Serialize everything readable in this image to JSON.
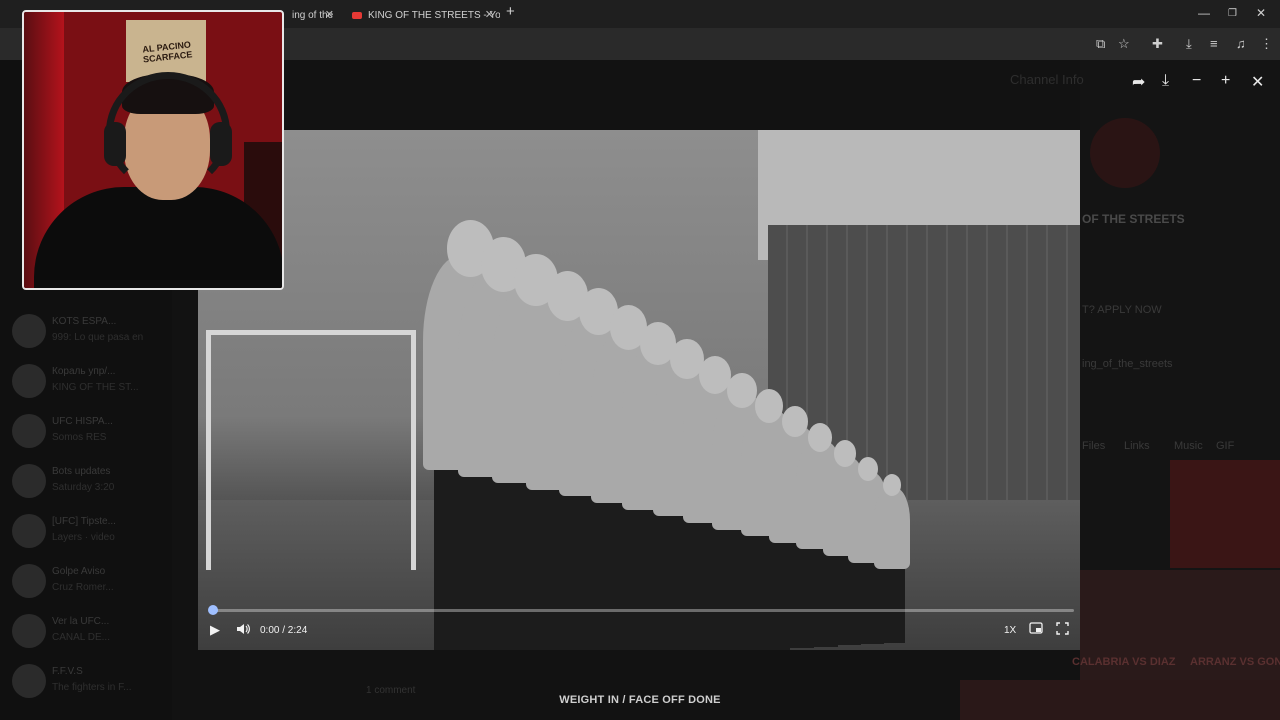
{
  "browser": {
    "tabs": [
      {
        "title": "ing of the"
      },
      {
        "title": "KING OF THE STREETS - YouTub"
      }
    ],
    "new_tab_symbol": "+",
    "window_controls": [
      "—",
      "❐",
      "✕"
    ]
  },
  "viewer_toolbar": {
    "icons": [
      "share-icon",
      "download-icon",
      "zoom-out-icon",
      "zoom-in-icon",
      "close-icon"
    ],
    "share": "➦",
    "download": "⤓",
    "zoom_out": "−",
    "zoom_in": "+",
    "close": "✕"
  },
  "background_app": {
    "chats": [
      {
        "name": "KOTS ESPA...",
        "preview": "999: Lo que pasa en"
      },
      {
        "name": "Корaль упр/...",
        "preview": "KING OF THE ST..."
      },
      {
        "name": "UFC HISPA...",
        "preview": "Somos RES"
      },
      {
        "name": "Bots updates",
        "preview": "Saturday 3:20"
      },
      {
        "name": "[UFC] Tipste...",
        "preview": "Layers · video"
      },
      {
        "name": "Golpe Aviso",
        "preview": "Cruz Romer..."
      },
      {
        "name": "Ver la UFC...",
        "preview": "CANAL DE..."
      },
      {
        "name": "F.F.V.S",
        "preview": "The fighters in F..."
      }
    ],
    "channel": {
      "header": "Channel Info",
      "name": "OF THE STREETS",
      "link": "ing_of_the_streets",
      "apply": "T? APPLY NOW",
      "tabs": [
        "Files",
        "Links",
        "Music",
        "GIF"
      ],
      "fight_names": [
        "CALABRIA VS DIAZ",
        "ARRANZ VS GONZALEZ"
      ]
    },
    "comment_label": "1 comment"
  },
  "video": {
    "current_time": "0:00",
    "duration": "2:24",
    "time_display": "0:00 / 2:24",
    "progress_fraction": 0.0,
    "speed": "1X",
    "play_icon": "▶",
    "volume_icon": "🔊",
    "pip_icon": "▭",
    "fullscreen_icon": "⛶",
    "accent_color": "#8fb3ff"
  },
  "webcam": {
    "poster_text": "AL PACINO SCARFACE"
  },
  "caption": "WEIGHT IN / FACE OFF DONE"
}
